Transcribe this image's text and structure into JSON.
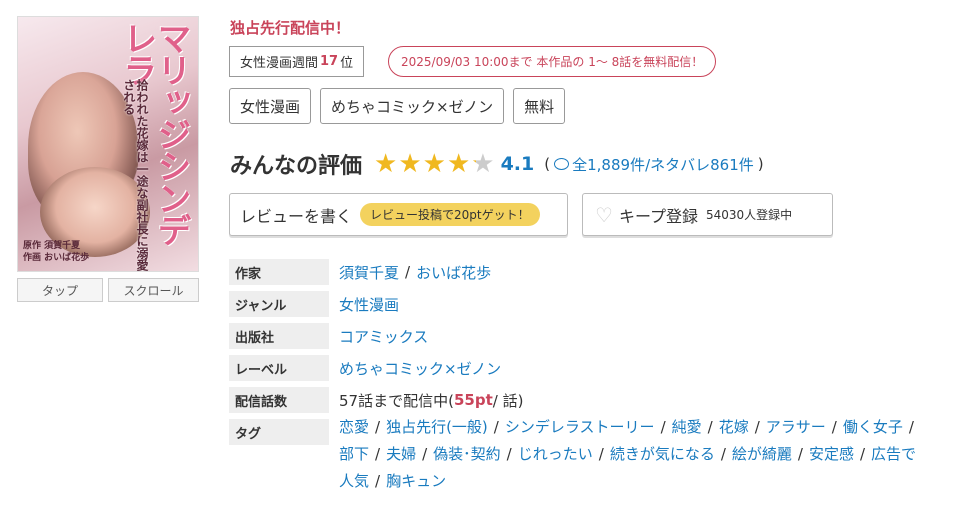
{
  "cover": {
    "title": "マリッジシンデレラ",
    "subtitle": "拾われた花嫁は一途な副社長に溺愛される",
    "original_credit": "原作 須賀千夏",
    "art_credit": "作画 おいば花歩",
    "buttons": [
      "タップ",
      "スクロール"
    ]
  },
  "header": {
    "exclusive": "独占先行配信中！",
    "rank_prefix": "女性漫画週間",
    "rank_num": "17",
    "rank_suffix": "位",
    "free_notice": "2025/09/03 10:00まで 本作品の 1〜 8話を無料配信！"
  },
  "top_tags": [
    "女性漫画",
    "めちゃコミック×ゼノン",
    "無料"
  ],
  "rating": {
    "label": "みんなの評価",
    "score": "4.1",
    "stars": 4.1,
    "open": "(",
    "reviews": "全1,889件",
    "spoilers": "/ネタバレ861件",
    "close": ")"
  },
  "review_button": {
    "label": "レビューを書く",
    "promo": "レビュー投稿で20ptゲット！"
  },
  "keep_button": {
    "label": "キープ登録",
    "count": "54030人登録中"
  },
  "info": {
    "author_label": "作家",
    "authors": [
      "須賀千夏",
      "おいば花歩"
    ],
    "genre_label": "ジャンル",
    "genre": "女性漫画",
    "publisher_label": "出版社",
    "publisher": "コアミックス",
    "label_label": "レーベル",
    "label": "めちゃコミック×ゼノン",
    "episodes_label": "配信話数",
    "episodes_pre": "57話まで配信中(",
    "episodes_price": "55pt",
    "episodes_post": " / 話)",
    "tags_label": "タグ",
    "tags": [
      "恋愛",
      "独占先行(一般)",
      "シンデレラストーリー",
      "純愛",
      "花嫁",
      "アラサー",
      "働く女子",
      "部下",
      "夫婦",
      "偽装･契約",
      "じれったい",
      "続きが気になる",
      "絵が綺麗",
      "安定感",
      "広告で人気",
      "胸キュン"
    ]
  },
  "colors": {
    "accent_red": "#c9445a",
    "link_blue": "#1a7bbf",
    "star": "#f0b820",
    "promo_yellow": "#f3d25e"
  }
}
